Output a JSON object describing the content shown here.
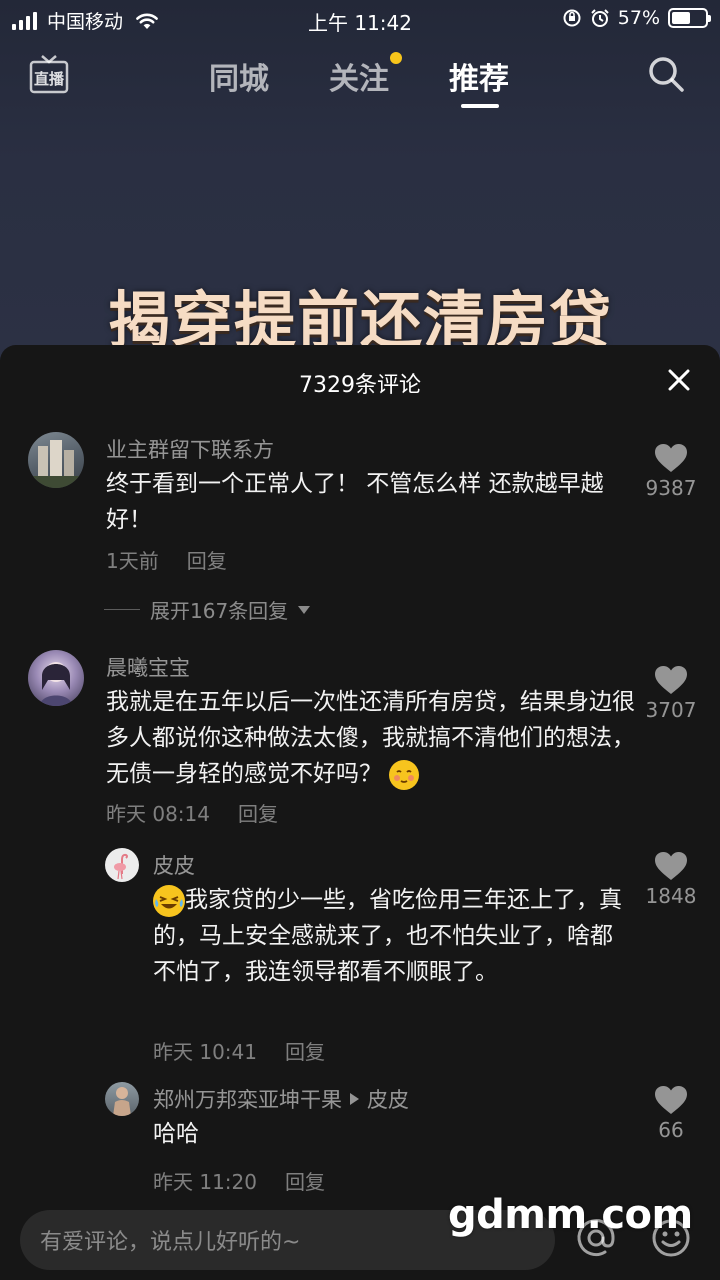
{
  "status_bar": {
    "carrier": "中国移动",
    "time": "上午 11:42",
    "battery": "57%",
    "battery_level": 0.57
  },
  "top_nav": {
    "live_label": "直播",
    "tabs": [
      {
        "label": "同城"
      },
      {
        "label": "关注"
      },
      {
        "label": "推荐"
      }
    ],
    "active_tab": "推荐"
  },
  "video": {
    "overlay_title": "揭穿提前还清房贷"
  },
  "comments_panel": {
    "title": "7329条评论",
    "comments": [
      {
        "username": "业主群留下联系方",
        "text": "终于看到一个正常人了！ 不管怎么样 还款越早越好！",
        "time": "1天前",
        "reply_label": "回复",
        "likes": "9387",
        "expand_label": "展开167条回复"
      },
      {
        "username": "晨曦宝宝",
        "text": "我就是在五年以后一次性还清所有房贷，结果身边很多人都说你这种做法太傻，我就搞不清他们的想法，无债一身轻的感觉不好吗？",
        "time": "昨天 08:14",
        "reply_label": "回复",
        "likes": "3707"
      }
    ],
    "replies": [
      {
        "username": "皮皮",
        "text": "我家贷的少一些，省吃俭用三年还上了，真的，马上安全感就来了，也不怕失业了，啥都不怕了，我连领导都看不顺眼了。",
        "time": "昨天 10:41",
        "reply_label": "回复",
        "likes": "1848"
      },
      {
        "username": "郑州万邦栾亚坤干果",
        "reply_to": "皮皮",
        "text": "哈哈",
        "time": "昨天 11:20",
        "reply_label": "回复",
        "likes": "66"
      }
    ]
  },
  "input": {
    "placeholder": "有爱评论，说点儿好听的~"
  },
  "watermark": "gdmm.com",
  "colors": {
    "panel_bg": "#161616",
    "follow_dot": "#f7c51b",
    "title_text": "#f6dcc4"
  }
}
